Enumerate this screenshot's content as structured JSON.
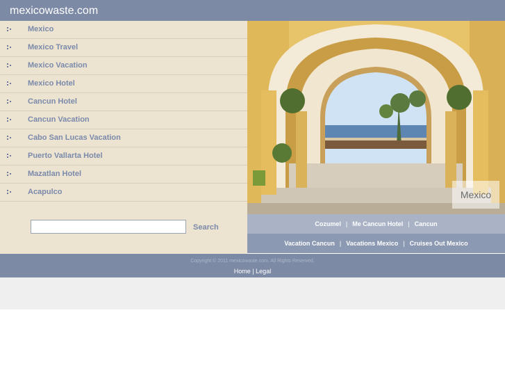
{
  "header": {
    "title": "mexicowaste.com"
  },
  "sidebar": {
    "items": [
      {
        "label": "Mexico"
      },
      {
        "label": "Mexico Travel"
      },
      {
        "label": "Mexico Vacation"
      },
      {
        "label": "Mexico Hotel"
      },
      {
        "label": "Cancun Hotel"
      },
      {
        "label": "Cancun Vacation"
      },
      {
        "label": "Cabo San Lucas Vacation"
      },
      {
        "label": "Puerto Vallarta Hotel"
      },
      {
        "label": "Mazatlan Hotel"
      },
      {
        "label": "Acapulco"
      }
    ]
  },
  "search": {
    "value": "",
    "placeholder": "",
    "button_label": "Search"
  },
  "photo": {
    "caption": "Mexico"
  },
  "links": {
    "row1": [
      "Cozumel",
      "Me Cancun Hotel",
      "Cancun"
    ],
    "row2": [
      "Vacation Cancun",
      "Vacations Mexico",
      "Cruises Out Mexico"
    ],
    "separator": "|"
  },
  "footer": {
    "copyright": "Copyright © 2011 mexicowaste.com. All Rights Reserved.",
    "home_label": "Home",
    "separator": "|",
    "legal_label": "Legal"
  },
  "colors": {
    "header_bg": "#7d8aa6",
    "sidebar_bg": "#ede3d1",
    "link_text": "#7a8aab",
    "links_row1_bg": "#aab3c6",
    "links_row2_bg": "#8c99b2"
  },
  "icons": {
    "nav_bullet": "dots-bullet-icon"
  }
}
